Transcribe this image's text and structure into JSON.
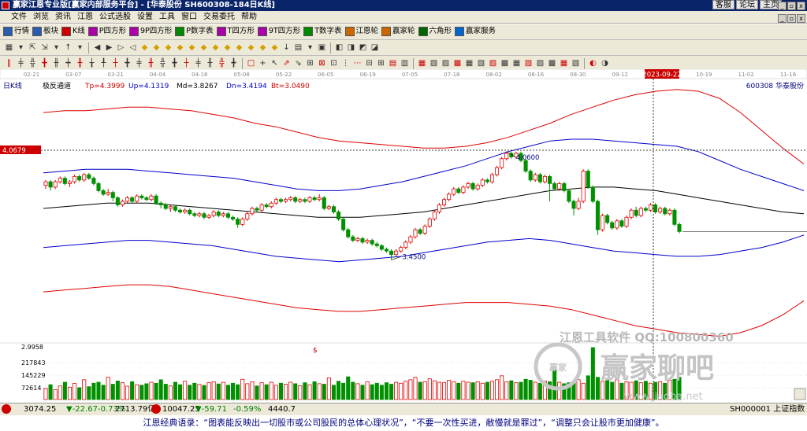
{
  "window": {
    "title": "赢家江恩专业版[赢家内部服务平台] - [华泰股份   SH600308-184日K线]",
    "links": [
      "客服",
      "论坛",
      "主页"
    ],
    "buttons": [
      "_",
      "▫",
      "x"
    ]
  },
  "menu": [
    "文件",
    "浏览",
    "资讯",
    "江恩",
    "公式选股",
    "设置",
    "工具",
    "窗口",
    "交易委托",
    "帮助"
  ],
  "toolbar_main": [
    {
      "label": "行情",
      "icon": "grid-icon"
    },
    {
      "label": "板块",
      "icon": "grid-icon"
    },
    {
      "label": "K线",
      "icon": "candle-icon"
    },
    {
      "label": "P四方形",
      "icon": "square-icon"
    },
    {
      "label": "9P四方形",
      "icon": "square-icon"
    },
    {
      "label": "P数字表",
      "icon": "table-icon"
    },
    {
      "label": "T四方形",
      "icon": "square-icon"
    },
    {
      "label": "9T四方形",
      "icon": "square-icon"
    },
    {
      "label": "T数字表",
      "icon": "table-icon"
    },
    {
      "label": "江恩轮",
      "icon": "wheel-icon"
    },
    {
      "label": "赢家轮",
      "icon": "wheel-icon"
    },
    {
      "label": "六角形",
      "icon": "hexagon-icon"
    },
    {
      "label": "赢家服务",
      "icon": "service-icon"
    }
  ],
  "period_label": "日K线",
  "indicator": {
    "name": "极反通道",
    "tp": "Tp=4.3999",
    "up": "Up=4.1319",
    "md": "Md=3.8267",
    "dn": "Dn=3.4194",
    "bt": "Bt=3.0490"
  },
  "stock_label": "600308  华泰股份",
  "date_axis": [
    "02-21",
    "03-07",
    "03-21",
    "04-04",
    "04-18",
    "05-08",
    "05-22",
    "06-05",
    "06-19",
    "07-05",
    "07-18",
    "08-02",
    "08-16",
    "08-30",
    "09-12",
    "2023-09-22",
    "10-19",
    "11-02",
    "11-16"
  ],
  "cursor_price": "4.0679",
  "price_annotations": {
    "high": "4.0600",
    "low": "3.4500"
  },
  "volume_axis": [
    "2.9958",
    "217843",
    "145229",
    "72614"
  ],
  "watermark": {
    "line1": "江恩工具软件  QQ:100800360",
    "line2": "赢家聊吧",
    "line3": "www.jiaoba.net",
    "seal": "赢家"
  },
  "status": {
    "sh": "3074.25",
    "sh_chg": "▼-22.67",
    "sh_pct": "-0.73%",
    "sh_amt": "2713.79亿",
    "sz": "10047.25",
    "sz_chg": "▼-59.71",
    "sz_pct": "-0.59%",
    "sz_amt": "4440.7",
    "right": "SH000001 上证指数"
  },
  "quote": "江恩经典语录：“图表能反映出一切股市或公司股民的总体心理状况”，“不要一次性买进，敝慢就是罪过”，“调整只会让股市更加健康”。",
  "colors": {
    "up": "#e00000",
    "down": "#009000",
    "upper_band": "#e00000",
    "mid_band": "#0000cc",
    "center": "#000000"
  },
  "chart_data": {
    "type": "candlestick",
    "symbol": "600308",
    "name": "华泰股份",
    "period": "日K线",
    "ylim": [
      2.9958,
      4.4
    ],
    "candles": [
      [
        3.87,
        3.89,
        3.9,
        3.85
      ],
      [
        3.89,
        3.86,
        3.9,
        3.84
      ],
      [
        3.86,
        3.89,
        3.9,
        3.85
      ],
      [
        3.89,
        3.91,
        3.92,
        3.88
      ],
      [
        3.91,
        3.88,
        3.92,
        3.87
      ],
      [
        3.88,
        3.89,
        3.9,
        3.86
      ],
      [
        3.89,
        3.92,
        3.93,
        3.88
      ],
      [
        3.92,
        3.9,
        3.93,
        3.89
      ],
      [
        3.9,
        3.93,
        3.94,
        3.89
      ],
      [
        3.93,
        3.91,
        3.94,
        3.9
      ],
      [
        3.91,
        3.88,
        3.92,
        3.87
      ],
      [
        3.88,
        3.84,
        3.89,
        3.83
      ],
      [
        3.84,
        3.82,
        3.85,
        3.81
      ],
      [
        3.82,
        3.83,
        3.85,
        3.81
      ],
      [
        3.83,
        3.8,
        3.84,
        3.78
      ],
      [
        3.8,
        3.76,
        3.81,
        3.75
      ],
      [
        3.76,
        3.78,
        3.79,
        3.75
      ],
      [
        3.78,
        3.8,
        3.81,
        3.77
      ],
      [
        3.8,
        3.78,
        3.81,
        3.77
      ],
      [
        3.78,
        3.81,
        3.82,
        3.77
      ],
      [
        3.81,
        3.8,
        3.82,
        3.79
      ],
      [
        3.8,
        3.79,
        3.81,
        3.78
      ],
      [
        3.79,
        3.81,
        3.82,
        3.78
      ],
      [
        3.81,
        3.77,
        3.82,
        3.76
      ],
      [
        3.77,
        3.76,
        3.78,
        3.74
      ],
      [
        3.76,
        3.74,
        3.77,
        3.73
      ],
      [
        3.74,
        3.75,
        3.76,
        3.72
      ],
      [
        3.75,
        3.73,
        3.76,
        3.72
      ],
      [
        3.73,
        3.72,
        3.74,
        3.71
      ],
      [
        3.72,
        3.73,
        3.74,
        3.71
      ],
      [
        3.73,
        3.71,
        3.74,
        3.7
      ],
      [
        3.71,
        3.7,
        3.72,
        3.69
      ],
      [
        3.7,
        3.71,
        3.72,
        3.69
      ],
      [
        3.71,
        3.69,
        3.72,
        3.68
      ],
      [
        3.69,
        3.7,
        3.71,
        3.68
      ],
      [
        3.7,
        3.72,
        3.73,
        3.69
      ],
      [
        3.72,
        3.7,
        3.73,
        3.69
      ],
      [
        3.7,
        3.71,
        3.72,
        3.69
      ],
      [
        3.71,
        3.69,
        3.72,
        3.68
      ],
      [
        3.69,
        3.68,
        3.7,
        3.67
      ],
      [
        3.68,
        3.65,
        3.69,
        3.63
      ],
      [
        3.65,
        3.68,
        3.69,
        3.64
      ],
      [
        3.68,
        3.71,
        3.72,
        3.67
      ],
      [
        3.71,
        3.74,
        3.75,
        3.7
      ],
      [
        3.74,
        3.73,
        3.75,
        3.72
      ],
      [
        3.73,
        3.76,
        3.77,
        3.72
      ],
      [
        3.76,
        3.75,
        3.77,
        3.74
      ],
      [
        3.75,
        3.77,
        3.78,
        3.74
      ],
      [
        3.77,
        3.79,
        3.8,
        3.76
      ],
      [
        3.79,
        3.78,
        3.8,
        3.77
      ],
      [
        3.78,
        3.79,
        3.8,
        3.77
      ],
      [
        3.79,
        3.8,
        3.81,
        3.78
      ],
      [
        3.8,
        3.78,
        3.81,
        3.77
      ],
      [
        3.78,
        3.79,
        3.8,
        3.77
      ],
      [
        3.79,
        3.78,
        3.8,
        3.77
      ],
      [
        3.78,
        3.8,
        3.81,
        3.77
      ],
      [
        3.8,
        3.79,
        3.81,
        3.78
      ],
      [
        3.79,
        3.8,
        3.82,
        3.78
      ],
      [
        3.8,
        3.74,
        3.81,
        3.73
      ],
      [
        3.74,
        3.75,
        3.76,
        3.73
      ],
      [
        3.75,
        3.72,
        3.76,
        3.71
      ],
      [
        3.72,
        3.68,
        3.73,
        3.67
      ],
      [
        3.68,
        3.62,
        3.69,
        3.61
      ],
      [
        3.62,
        3.58,
        3.63,
        3.57
      ],
      [
        3.58,
        3.56,
        3.59,
        3.55
      ],
      [
        3.56,
        3.57,
        3.58,
        3.55
      ],
      [
        3.57,
        3.55,
        3.58,
        3.54
      ],
      [
        3.55,
        3.56,
        3.57,
        3.54
      ],
      [
        3.56,
        3.54,
        3.57,
        3.53
      ],
      [
        3.54,
        3.53,
        3.55,
        3.52
      ],
      [
        3.53,
        3.51,
        3.54,
        3.5
      ],
      [
        3.51,
        3.5,
        3.52,
        3.49
      ],
      [
        3.5,
        3.48,
        3.51,
        3.45
      ],
      [
        3.48,
        3.5,
        3.51,
        3.47
      ],
      [
        3.5,
        3.52,
        3.53,
        3.49
      ],
      [
        3.52,
        3.55,
        3.56,
        3.51
      ],
      [
        3.55,
        3.58,
        3.59,
        3.54
      ],
      [
        3.58,
        3.62,
        3.63,
        3.57
      ],
      [
        3.62,
        3.6,
        3.63,
        3.59
      ],
      [
        3.6,
        3.64,
        3.65,
        3.59
      ],
      [
        3.64,
        3.68,
        3.69,
        3.63
      ],
      [
        3.68,
        3.72,
        3.73,
        3.67
      ],
      [
        3.72,
        3.76,
        3.77,
        3.71
      ],
      [
        3.76,
        3.79,
        3.8,
        3.75
      ],
      [
        3.79,
        3.82,
        3.83,
        3.78
      ],
      [
        3.82,
        3.85,
        3.86,
        3.81
      ],
      [
        3.85,
        3.83,
        3.86,
        3.82
      ],
      [
        3.83,
        3.86,
        3.87,
        3.82
      ],
      [
        3.86,
        3.88,
        3.89,
        3.85
      ],
      [
        3.88,
        3.85,
        3.89,
        3.84
      ],
      [
        3.85,
        3.87,
        3.88,
        3.84
      ],
      [
        3.87,
        3.9,
        3.91,
        3.86
      ],
      [
        3.9,
        3.89,
        3.91,
        3.88
      ],
      [
        3.89,
        3.93,
        3.94,
        3.88
      ],
      [
        3.93,
        3.97,
        3.98,
        3.92
      ],
      [
        3.97,
        4.02,
        4.03,
        3.96
      ],
      [
        4.02,
        4.05,
        4.06,
        4.01
      ],
      [
        4.05,
        4.03,
        4.06,
        4.02
      ],
      [
        4.03,
        4.05,
        4.06,
        4.02
      ],
      [
        4.05,
        4.01,
        4.06,
        4.0
      ],
      [
        4.01,
        3.95,
        4.02,
        3.94
      ],
      [
        3.95,
        3.9,
        3.96,
        3.89
      ],
      [
        3.9,
        3.93,
        3.94,
        3.89
      ],
      [
        3.93,
        3.89,
        3.94,
        3.88
      ],
      [
        3.89,
        3.92,
        3.93,
        3.88
      ],
      [
        3.92,
        3.88,
        3.93,
        3.78
      ],
      [
        3.88,
        3.85,
        3.89,
        3.84
      ],
      [
        3.85,
        3.88,
        3.89,
        3.84
      ],
      [
        3.88,
        3.84,
        3.89,
        3.83
      ],
      [
        3.84,
        3.78,
        3.85,
        3.77
      ],
      [
        3.78,
        3.74,
        3.79,
        3.7
      ],
      [
        3.74,
        3.78,
        3.8,
        3.73
      ],
      [
        3.78,
        3.95,
        3.96,
        3.77
      ],
      [
        3.95,
        3.86,
        3.96,
        3.85
      ],
      [
        3.86,
        3.78,
        3.87,
        3.77
      ],
      [
        3.78,
        3.62,
        3.79,
        3.59
      ],
      [
        3.62,
        3.7,
        3.71,
        3.61
      ],
      [
        3.7,
        3.66,
        3.71,
        3.65
      ],
      [
        3.66,
        3.63,
        3.67,
        3.62
      ],
      [
        3.63,
        3.67,
        3.68,
        3.62
      ],
      [
        3.67,
        3.64,
        3.68,
        3.63
      ],
      [
        3.64,
        3.69,
        3.7,
        3.63
      ],
      [
        3.69,
        3.73,
        3.74,
        3.68
      ],
      [
        3.73,
        3.7,
        3.75,
        3.69
      ],
      [
        3.7,
        3.74,
        3.75,
        3.69
      ],
      [
        3.74,
        3.73,
        3.75,
        3.72
      ],
      [
        3.73,
        3.76,
        3.77,
        3.72
      ],
      [
        3.76,
        3.72,
        3.77,
        3.71
      ],
      [
        3.72,
        3.74,
        3.75,
        3.71
      ],
      [
        3.74,
        3.71,
        3.75,
        3.7
      ],
      [
        3.71,
        3.73,
        3.74,
        3.7
      ],
      [
        3.73,
        3.65,
        3.74,
        3.64
      ],
      [
        3.65,
        3.61,
        3.66,
        3.6
      ]
    ],
    "volumes": [
      45,
      60,
      40,
      55,
      70,
      50,
      65,
      48,
      80,
      52,
      66,
      70,
      58,
      90,
      62,
      75,
      68,
      54,
      72,
      60,
      58,
      64,
      70,
      66,
      80,
      62,
      55,
      70,
      60,
      74,
      58,
      66,
      61,
      57,
      69,
      72,
      63,
      70,
      58,
      66,
      60,
      82,
      64,
      72,
      55,
      68,
      60,
      70,
      58,
      66,
      62,
      70,
      64,
      56,
      68,
      60,
      72,
      64,
      62,
      88,
      58,
      74,
      66,
      92,
      70,
      64,
      58,
      72,
      60,
      66,
      58,
      68,
      62,
      70,
      66,
      74,
      80,
      90,
      70,
      72,
      84,
      76,
      70,
      68,
      78,
      72,
      66,
      74,
      70,
      68,
      72,
      66,
      70,
      74,
      80,
      96,
      72,
      76,
      68,
      70,
      82,
      78,
      70,
      66,
      74,
      72,
      120,
      70,
      64,
      68,
      72,
      80,
      66,
      96,
      210,
      90,
      74,
      84,
      70,
      80,
      66,
      72,
      70,
      76,
      68,
      74,
      66,
      70,
      72,
      66,
      78,
      82,
      90
    ],
    "bands": {
      "top": [
        4.28,
        4.29,
        4.29,
        4.3,
        4.31,
        4.31,
        4.3,
        4.29,
        4.27,
        4.25,
        4.22,
        4.2,
        4.17,
        4.14,
        4.12,
        4.11,
        4.1,
        4.09,
        4.08,
        4.08,
        4.09,
        4.11,
        4.14,
        4.18,
        4.22,
        4.27,
        4.31,
        4.35,
        4.38,
        4.4,
        4.41,
        4.4,
        4.36,
        4.28,
        4.18,
        4.08,
        3.99
      ],
      "upper": [
        3.94,
        3.95,
        3.96,
        3.96,
        3.96,
        3.95,
        3.94,
        3.93,
        3.92,
        3.91,
        3.89,
        3.87,
        3.85,
        3.84,
        3.84,
        3.85,
        3.87,
        3.89,
        3.92,
        3.95,
        3.98,
        4.02,
        4.06,
        4.09,
        4.12,
        4.13,
        4.13,
        4.12,
        4.11,
        4.1,
        4.09,
        4.06,
        4.01,
        3.96,
        3.92,
        3.88,
        3.84
      ],
      "mid": [
        3.74,
        3.75,
        3.76,
        3.77,
        3.77,
        3.77,
        3.76,
        3.75,
        3.74,
        3.73,
        3.72,
        3.71,
        3.7,
        3.69,
        3.69,
        3.69,
        3.7,
        3.71,
        3.72,
        3.74,
        3.76,
        3.78,
        3.8,
        3.82,
        3.84,
        3.85,
        3.86,
        3.86,
        3.85,
        3.84,
        3.82,
        3.8,
        3.78,
        3.76,
        3.74,
        3.72,
        3.71
      ],
      "lower": [
        3.52,
        3.53,
        3.54,
        3.55,
        3.56,
        3.56,
        3.55,
        3.54,
        3.53,
        3.51,
        3.49,
        3.47,
        3.46,
        3.45,
        3.44,
        3.45,
        3.46,
        3.47,
        3.49,
        3.51,
        3.53,
        3.55,
        3.56,
        3.57,
        3.56,
        3.54,
        3.52,
        3.5,
        3.49,
        3.48,
        3.47,
        3.47,
        3.48,
        3.5,
        3.52,
        3.55,
        3.59
      ],
      "bottom": [
        3.27,
        3.28,
        3.29,
        3.3,
        3.31,
        3.31,
        3.3,
        3.28,
        3.26,
        3.24,
        3.22,
        3.2,
        3.18,
        3.17,
        3.16,
        3.16,
        3.17,
        3.18,
        3.19,
        3.2,
        3.21,
        3.21,
        3.21,
        3.2,
        3.19,
        3.17,
        3.14,
        3.11,
        3.08,
        3.06,
        3.04,
        3.03,
        3.02,
        3.04,
        3.08,
        3.14,
        3.22
      ]
    }
  }
}
